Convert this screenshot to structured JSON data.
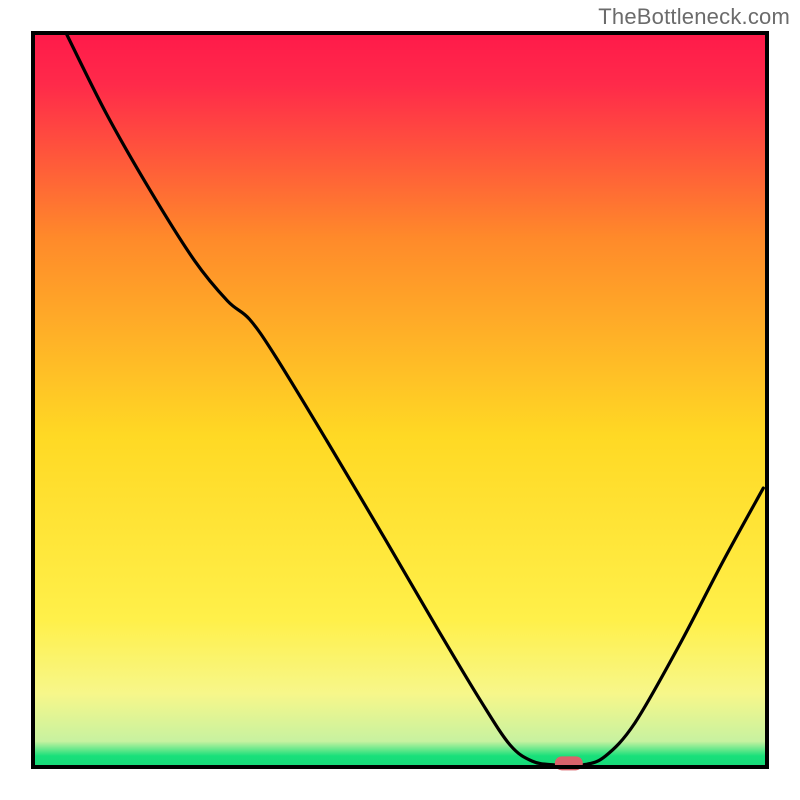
{
  "watermark": "TheBottleneck.com",
  "chart_data": {
    "type": "line",
    "title": "",
    "xlabel": "",
    "ylabel": "",
    "xlim": [
      0,
      100
    ],
    "ylim": [
      0,
      100
    ],
    "grid": false,
    "legend": false,
    "gradient_colors": {
      "top": "#ff1a4a",
      "upper_mid": "#ff8a2a",
      "mid": "#ffd924",
      "lower_mid": "#f7f78a",
      "bottom": "#18e07a"
    },
    "curve_points": [
      {
        "x": 4.5,
        "y": 100.0
      },
      {
        "x": 10.0,
        "y": 89.0
      },
      {
        "x": 16.0,
        "y": 78.5
      },
      {
        "x": 22.0,
        "y": 69.0
      },
      {
        "x": 26.5,
        "y": 63.5
      },
      {
        "x": 29.5,
        "y": 61.0
      },
      {
        "x": 33.0,
        "y": 56.0
      },
      {
        "x": 40.0,
        "y": 44.5
      },
      {
        "x": 48.0,
        "y": 31.0
      },
      {
        "x": 55.0,
        "y": 19.0
      },
      {
        "x": 61.0,
        "y": 9.0
      },
      {
        "x": 65.0,
        "y": 3.0
      },
      {
        "x": 68.0,
        "y": 0.8
      },
      {
        "x": 71.0,
        "y": 0.3
      },
      {
        "x": 75.0,
        "y": 0.3
      },
      {
        "x": 78.0,
        "y": 1.5
      },
      {
        "x": 82.0,
        "y": 6.0
      },
      {
        "x": 88.0,
        "y": 16.5
      },
      {
        "x": 94.0,
        "y": 28.0
      },
      {
        "x": 99.5,
        "y": 38.0
      }
    ],
    "marker": {
      "x": 73.0,
      "y": 0.5,
      "color": "#d9636b",
      "shape": "rounded-rect"
    },
    "description": "V-shaped bottleneck curve over red-to-green vertical gradient, minimum near x≈73"
  }
}
